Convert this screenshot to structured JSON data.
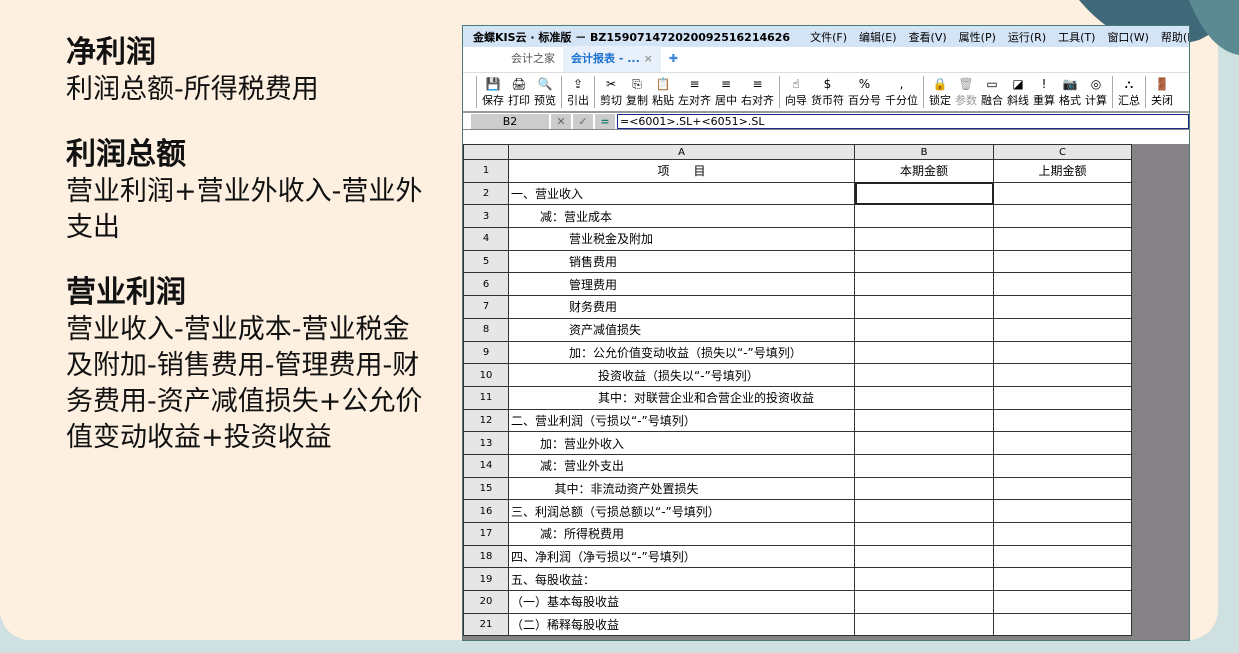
{
  "left": {
    "sections": [
      {
        "title": "净利润",
        "body": "利润总额-所得税费用"
      },
      {
        "title": "利润总额",
        "body": "营业利润+营业外收入-营业外支出"
      },
      {
        "title": "营业利润",
        "body": "营业收入-营业成本-营业税金及附加-销售费用-管理费用-财务费用-资产减值损失+公允价值变动收益+投资收益"
      }
    ]
  },
  "window": {
    "title": "金蝶KIS云 · 标准版 － BZ159071472020092516214626",
    "menu": [
      "文件(F)",
      "编辑(E)",
      "查看(V)",
      "属性(P)",
      "运行(R)",
      "工具(T)",
      "窗口(W)",
      "帮助(H)"
    ],
    "tabs": [
      "会计之家",
      "会计报表 - ..."
    ],
    "toolbar": [
      {
        "label": "保存",
        "icon": "💾"
      },
      {
        "label": "打印",
        "icon": "🖨"
      },
      {
        "label": "预览",
        "icon": "🔍"
      },
      {
        "label": "引出",
        "icon": "⇪"
      },
      {
        "label": "剪切",
        "icon": "✂"
      },
      {
        "label": "复制",
        "icon": "⎘"
      },
      {
        "label": "粘贴",
        "icon": "📋"
      },
      {
        "label": "左对齐",
        "icon": "≡"
      },
      {
        "label": "居中",
        "icon": "≡"
      },
      {
        "label": "右对齐",
        "icon": "≡"
      },
      {
        "label": "向导",
        "icon": "☝"
      },
      {
        "label": "货币符",
        "icon": "$"
      },
      {
        "label": "百分号",
        "icon": "%"
      },
      {
        "label": "千分位",
        "icon": ","
      },
      {
        "label": "锁定",
        "icon": "🔒"
      },
      {
        "label": "参数",
        "icon": "🗑"
      },
      {
        "label": "融合",
        "icon": "▭"
      },
      {
        "label": "斜线",
        "icon": "◪"
      },
      {
        "label": "重算",
        "icon": "!"
      },
      {
        "label": "格式",
        "icon": "📷"
      },
      {
        "label": "计算",
        "icon": "◎"
      },
      {
        "label": "汇总",
        "icon": "⛬"
      },
      {
        "label": "关闭",
        "icon": "🚪"
      }
    ],
    "cell_ref": "B2",
    "formula": "=<6001>.SL+<6051>.SL"
  },
  "sheet": {
    "columns": [
      "A",
      "B",
      "C"
    ],
    "rows": [
      {
        "n": "1",
        "a": "项　　目",
        "b": "本期金额",
        "c": "上期金额",
        "indent": 0
      },
      {
        "n": "2",
        "a": "一、营业收入",
        "indent": 0
      },
      {
        "n": "3",
        "a": "减：营业成本",
        "indent": 1
      },
      {
        "n": "4",
        "a": "营业税金及附加",
        "indent": 2
      },
      {
        "n": "5",
        "a": "销售费用",
        "indent": 2
      },
      {
        "n": "6",
        "a": "管理费用",
        "indent": 2
      },
      {
        "n": "7",
        "a": "财务费用",
        "indent": 2
      },
      {
        "n": "8",
        "a": "资产减值损失",
        "indent": 2
      },
      {
        "n": "9",
        "a": "加：公允价值变动收益（损失以“-”号填列）",
        "indent": 2
      },
      {
        "n": "10",
        "a": "投资收益（损失以“-”号填列）",
        "indent": 3
      },
      {
        "n": "11",
        "a": "其中：对联营企业和合营企业的投资收益",
        "indent": 3
      },
      {
        "n": "12",
        "a": "二、营业利润（亏损以“-”号填列）",
        "indent": 0
      },
      {
        "n": "13",
        "a": "加：营业外收入",
        "indent": 1
      },
      {
        "n": "14",
        "a": "减：营业外支出",
        "indent": 1
      },
      {
        "n": "15",
        "a": "其中：非流动资产处置损失",
        "indent": 1.5
      },
      {
        "n": "16",
        "a": "三、利润总额（亏损总额以“-”号填列）",
        "indent": 0
      },
      {
        "n": "17",
        "a": "减：所得税费用",
        "indent": 1
      },
      {
        "n": "18",
        "a": "四、净利润（净亏损以“-”号填列）",
        "indent": 0
      },
      {
        "n": "19",
        "a": "五、每股收益：",
        "indent": 0
      },
      {
        "n": "20",
        "a": "（一）基本每股收益",
        "indent": 0
      },
      {
        "n": "21",
        "a": "（二）稀释每股收益",
        "indent": 0
      }
    ]
  }
}
